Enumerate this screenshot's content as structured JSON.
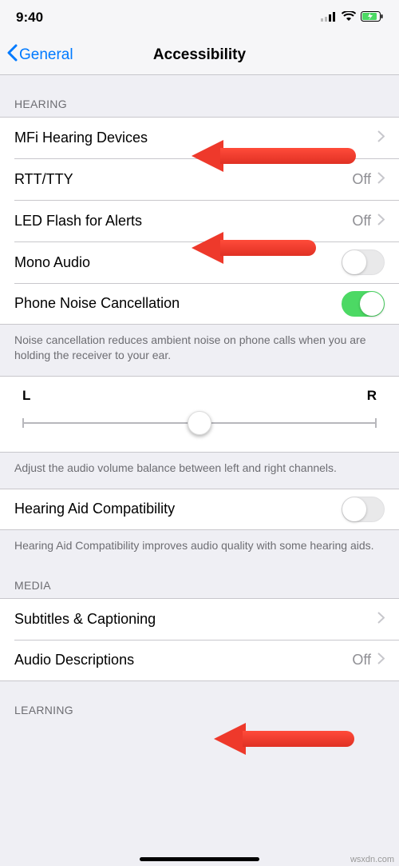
{
  "status": {
    "time": "9:40"
  },
  "nav": {
    "back": "General",
    "title": "Accessibility"
  },
  "sections": {
    "hearing_header": "HEARING",
    "media_header": "MEDIA",
    "learning_header": "LEARNING"
  },
  "rows": {
    "mfi": {
      "label": "MFi Hearing Devices"
    },
    "rtt": {
      "label": "RTT/TTY",
      "value": "Off"
    },
    "led": {
      "label": "LED Flash for Alerts",
      "value": "Off"
    },
    "mono": {
      "label": "Mono Audio"
    },
    "noise": {
      "label": "Phone Noise Cancellation"
    },
    "hac": {
      "label": "Hearing Aid Compatibility"
    },
    "subs": {
      "label": "Subtitles & Captioning"
    },
    "audiodesc": {
      "label": "Audio Descriptions",
      "value": "Off"
    }
  },
  "footers": {
    "noise": "Noise cancellation reduces ambient noise on phone calls when you are holding the receiver to your ear.",
    "balance": "Adjust the audio volume balance between left and right channels.",
    "hac": "Hearing Aid Compatibility improves audio quality with some hearing aids."
  },
  "slider": {
    "left": "L",
    "right": "R"
  },
  "watermark": "wsxdn.com"
}
